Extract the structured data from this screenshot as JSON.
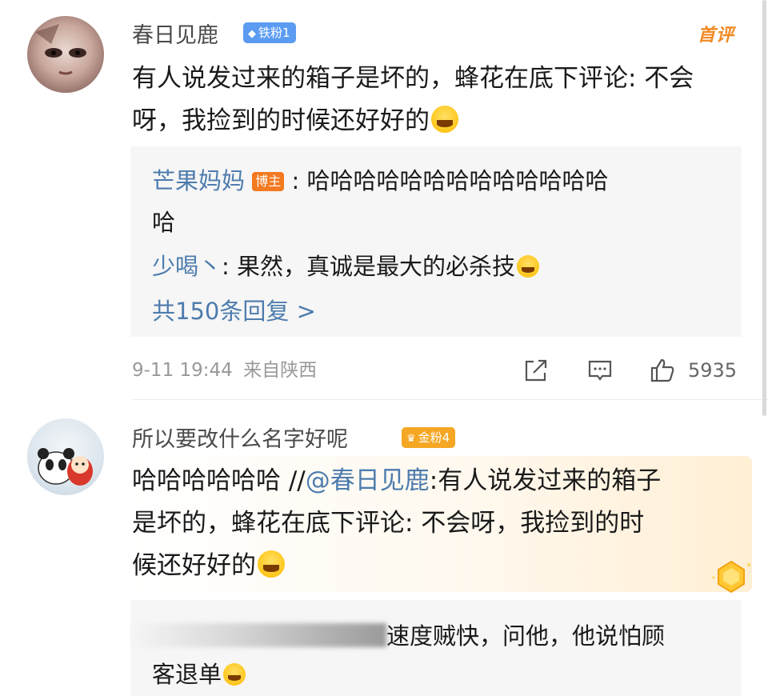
{
  "comments": [
    {
      "username": "春日见鹿",
      "badge": "铁粉1",
      "sort_label": "首评",
      "text": "有人说发过来的箱子是坏的，蜂花在底下评论: 不会呀，我捡到的时候还好好的",
      "replies": [
        {
          "user": "芒果妈妈",
          "tag": "博主",
          "text_line1": ": 哈哈哈哈哈哈哈哈哈哈哈哈哈",
          "text_line2": "哈"
        },
        {
          "user": "少喝丶",
          "text": ": 果然，真诚是最大的必杀技"
        }
      ],
      "more_replies": "共150条回复 >",
      "timestamp": "9-11 19:44",
      "location": "来自陕西",
      "likes": "5935"
    },
    {
      "username": "所以要改什么名字好呢",
      "badge": "金粉4",
      "text_prefix": "哈哈哈哈哈哈 //",
      "mention": "@春日见鹿",
      "text_line1_rest": ":有人说发过来的箱子",
      "text_line2": "是坏的，蜂花在底下评论: 不会呀，我捡到的时",
      "text_line3": "候还好好的",
      "reply_partial_line1": "速度贼快，问他，他说怕顾",
      "reply_partial_line2": "客退单"
    }
  ],
  "icons": {
    "share": "share-icon",
    "comment": "comment-icon",
    "like": "thumbs-up-icon",
    "emoji": "laughing-emoji-icon",
    "badge_diamond": "diamond-icon"
  },
  "colors": {
    "link_blue": "#4d7cad",
    "badge_blue": "#5b9cf2",
    "badge_gold": "#f5a623",
    "host_tag": "#f37a20",
    "sort_orange": "#f08a24"
  }
}
